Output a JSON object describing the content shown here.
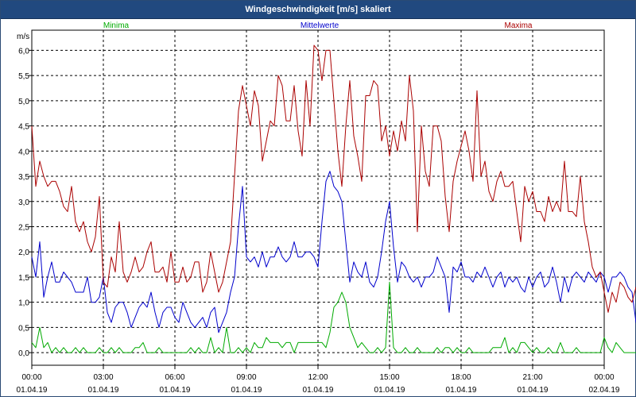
{
  "window": {
    "title": "Windgeschwindigkeit [m/s] skaliert"
  },
  "chart_data": {
    "type": "line",
    "title": "Windgeschwindigkeit [m/s] skaliert",
    "ylabel": "m/s",
    "xlabel": "",
    "ylim": [
      -0.25,
      6.4
    ],
    "xlim": [
      "2019-04-01T00:00",
      "2019-04-02T00:00"
    ],
    "y_ticks": [
      "0,0",
      "0,5",
      "1,0",
      "1,5",
      "2,0",
      "2,5",
      "3,0",
      "3,5",
      "4,0",
      "4,5",
      "5,0",
      "5,5",
      "6,0"
    ],
    "x_ticks": [
      {
        "time": "00:00",
        "date": "01.04.19"
      },
      {
        "time": "03:00",
        "date": "01.04.19"
      },
      {
        "time": "06:00",
        "date": "01.04.19"
      },
      {
        "time": "09:00",
        "date": "01.04.19"
      },
      {
        "time": "12:00",
        "date": "01.04.19"
      },
      {
        "time": "15:00",
        "date": "01.04.19"
      },
      {
        "time": "18:00",
        "date": "01.04.19"
      },
      {
        "time": "21:00",
        "date": "01.04.19"
      },
      {
        "time": "00:00",
        "date": "02.04.19"
      }
    ],
    "grid": true,
    "legend_position": "top",
    "x": [
      "00:00",
      "00:10",
      "00:20",
      "00:30",
      "00:40",
      "00:50",
      "01:00",
      "01:10",
      "01:20",
      "01:30",
      "01:40",
      "01:50",
      "02:00",
      "02:10",
      "02:20",
      "02:30",
      "02:40",
      "02:50",
      "03:00",
      "03:10",
      "03:20",
      "03:30",
      "03:40",
      "03:50",
      "04:00",
      "04:10",
      "04:20",
      "04:30",
      "04:40",
      "04:50",
      "05:00",
      "05:10",
      "05:20",
      "05:30",
      "05:40",
      "05:50",
      "06:00",
      "06:10",
      "06:20",
      "06:30",
      "06:40",
      "06:50",
      "07:00",
      "07:10",
      "07:20",
      "07:30",
      "07:40",
      "07:50",
      "08:00",
      "08:10",
      "08:20",
      "08:30",
      "08:40",
      "08:50",
      "09:00",
      "09:10",
      "09:20",
      "09:30",
      "09:40",
      "09:50",
      "10:00",
      "10:10",
      "10:20",
      "10:30",
      "10:40",
      "10:50",
      "11:00",
      "11:10",
      "11:20",
      "11:30",
      "11:40",
      "11:50",
      "12:00",
      "12:10",
      "12:20",
      "12:30",
      "12:40",
      "12:50",
      "13:00",
      "13:10",
      "13:20",
      "13:30",
      "13:40",
      "13:50",
      "14:00",
      "14:10",
      "14:20",
      "14:30",
      "14:40",
      "14:50",
      "15:00",
      "15:10",
      "15:20",
      "15:30",
      "15:40",
      "15:50",
      "16:00",
      "16:10",
      "16:20",
      "16:30",
      "16:40",
      "16:50",
      "17:00",
      "17:10",
      "17:20",
      "17:30",
      "17:40",
      "17:50",
      "18:00",
      "18:10",
      "18:20",
      "18:30",
      "18:40",
      "18:50",
      "19:00",
      "19:10",
      "19:20",
      "19:30",
      "19:40",
      "19:50",
      "20:00",
      "20:10",
      "20:20",
      "20:30",
      "20:40",
      "20:50",
      "21:00",
      "21:10",
      "21:20",
      "21:30",
      "21:40",
      "21:50",
      "22:00",
      "22:10",
      "22:20",
      "22:30",
      "22:40",
      "22:50",
      "23:00",
      "23:10",
      "23:20",
      "23:30",
      "23:40",
      "23:50",
      "00:00"
    ],
    "series": [
      {
        "name": "Minima",
        "color": "#00aa00",
        "values": [
          0.2,
          0.1,
          0.5,
          0.1,
          0.2,
          0.0,
          0.1,
          0.0,
          0.1,
          0.0,
          0.0,
          0.1,
          0.0,
          0.1,
          0.0,
          0.0,
          0.0,
          0.1,
          0.0,
          0.0,
          0.1,
          0.0,
          0.1,
          0.0,
          0.0,
          0.0,
          0.1,
          0.1,
          0.2,
          0.0,
          0.0,
          0.0,
          0.1,
          0.0,
          0.0,
          0.0,
          0.0,
          0.0,
          0.0,
          0.0,
          0.1,
          0.0,
          0.1,
          0.0,
          0.0,
          0.3,
          0.0,
          0.1,
          0.0,
          0.5,
          0.0,
          0.0,
          0.1,
          0.0,
          0.1,
          0.0,
          0.2,
          0.1,
          0.1,
          0.3,
          0.2,
          0.2,
          0.2,
          0.1,
          0.2,
          0.2,
          0.0,
          0.2,
          0.2,
          0.2,
          0.2,
          0.2,
          0.2,
          0.2,
          0.1,
          0.4,
          0.9,
          1.0,
          1.2,
          1.0,
          0.5,
          0.3,
          0.1,
          0.2,
          0.1,
          0.0,
          0.0,
          0.1,
          0.0,
          0.1,
          1.4,
          0.1,
          0.0,
          0.0,
          0.1,
          0.0,
          0.0,
          0.1,
          0.0,
          0.0,
          0.0,
          0.0,
          0.1,
          0.0,
          0.1,
          0.1,
          0.0,
          0.1,
          0.0,
          0.0,
          0.1,
          0.0,
          0.0,
          0.0,
          0.0,
          0.0,
          0.1,
          0.1,
          0.1,
          0.3,
          0.0,
          0.1,
          0.0,
          0.2,
          0.2,
          0.1,
          0.0,
          0.1,
          0.0,
          0.0,
          0.1,
          0.0,
          0.0,
          0.2,
          0.0,
          0.0,
          0.0,
          0.1,
          0.0,
          0.0,
          0.0,
          0.0,
          0.0,
          0.0,
          0.3,
          0.1,
          0.0,
          0.2,
          0.1,
          0.0,
          0.0,
          0.0,
          0.0,
          0.0,
          0.0,
          0.0,
          0.0
        ]
      },
      {
        "name": "Mittelwerte",
        "color": "#0000cc",
        "values": [
          1.9,
          1.5,
          2.2,
          1.1,
          1.5,
          1.8,
          1.4,
          1.4,
          1.6,
          1.5,
          1.4,
          1.2,
          1.2,
          1.2,
          1.5,
          1.0,
          1.0,
          1.1,
          1.5,
          0.8,
          0.6,
          0.9,
          1.0,
          1.0,
          0.8,
          0.5,
          0.7,
          0.9,
          1.0,
          0.9,
          1.2,
          0.8,
          0.5,
          0.8,
          0.9,
          0.9,
          0.7,
          0.6,
          1.0,
          0.8,
          0.6,
          0.5,
          0.6,
          0.7,
          0.5,
          0.8,
          0.9,
          0.4,
          0.6,
          0.8,
          1.2,
          1.5,
          2.5,
          3.3,
          1.9,
          1.8,
          1.9,
          1.7,
          2.0,
          1.7,
          1.9,
          1.9,
          2.1,
          1.9,
          1.8,
          1.9,
          2.2,
          1.9,
          1.9,
          2.0,
          2.0,
          1.9,
          1.7,
          2.6,
          3.4,
          3.6,
          3.3,
          3.2,
          3.0,
          2.2,
          1.4,
          1.8,
          1.6,
          1.5,
          1.8,
          1.4,
          1.3,
          1.5,
          2.0,
          2.6,
          3.0,
          2.1,
          1.4,
          1.8,
          1.7,
          1.5,
          1.4,
          1.5,
          1.3,
          1.5,
          1.5,
          1.6,
          1.9,
          1.7,
          1.5,
          0.8,
          1.7,
          1.6,
          1.8,
          1.5,
          1.5,
          1.4,
          1.6,
          1.5,
          1.7,
          1.5,
          1.3,
          1.5,
          1.6,
          1.3,
          1.5,
          1.4,
          1.5,
          1.3,
          1.2,
          1.5,
          1.3,
          1.5,
          1.6,
          1.3,
          1.4,
          1.7,
          1.4,
          1.0,
          1.5,
          1.2,
          1.5,
          1.6,
          1.5,
          1.4,
          1.6,
          1.5,
          1.4,
          1.6,
          1.5,
          1.2,
          1.5,
          1.5,
          1.6,
          1.5,
          1.3,
          1.2,
          0.6,
          0.5,
          0.6,
          0.5,
          0.4,
          0.7,
          0.5,
          0.3,
          0.7,
          0.6,
          0.8,
          0.4,
          0.6,
          0.5,
          0.5
        ]
      },
      {
        "name": "Maxima",
        "color": "#aa0000",
        "values": [
          4.5,
          3.3,
          3.8,
          3.5,
          3.3,
          3.4,
          3.4,
          3.2,
          2.9,
          2.8,
          3.3,
          2.6,
          2.4,
          2.6,
          2.2,
          2.0,
          2.3,
          3.1,
          1.4,
          1.3,
          1.9,
          1.6,
          2.6,
          1.6,
          1.4,
          1.6,
          1.9,
          1.6,
          1.7,
          2.0,
          2.2,
          1.6,
          1.6,
          1.7,
          1.4,
          2.0,
          1.4,
          1.4,
          1.7,
          1.4,
          1.5,
          1.8,
          1.8,
          1.2,
          1.4,
          2.0,
          1.6,
          1.2,
          1.4,
          1.8,
          2.2,
          3.5,
          4.8,
          5.3,
          4.9,
          4.5,
          5.2,
          4.9,
          3.8,
          4.2,
          4.6,
          4.5,
          5.5,
          5.3,
          4.6,
          4.6,
          5.3,
          4.4,
          3.9,
          5.4,
          4.5,
          6.1,
          6.0,
          5.4,
          6.0,
          6.0,
          5.0,
          4.0,
          3.3,
          4.5,
          5.4,
          4.3,
          3.9,
          3.4,
          5.1,
          5.1,
          5.4,
          5.3,
          4.2,
          4.5,
          3.9,
          4.4,
          4.0,
          4.6,
          4.2,
          5.5,
          4.8,
          2.4,
          4.5,
          3.6,
          3.3,
          4.5,
          4.5,
          4.2,
          3.1,
          2.4,
          3.4,
          3.8,
          4.1,
          4.4,
          4.0,
          3.4,
          5.2,
          3.5,
          3.8,
          3.2,
          3.0,
          3.4,
          3.6,
          3.3,
          3.3,
          3.4,
          2.8,
          2.2,
          3.3,
          3.0,
          3.2,
          2.8,
          2.8,
          2.6,
          3.1,
          2.8,
          3.0,
          2.8,
          3.8,
          2.8,
          2.8,
          2.7,
          3.5,
          2.6,
          2.2,
          1.7,
          1.5,
          1.6,
          1.2,
          0.8,
          1.2,
          1.0,
          1.4,
          1.3,
          1.1,
          1.0,
          1.3,
          1.2,
          1.1,
          1.3,
          0.8
        ]
      }
    ]
  }
}
